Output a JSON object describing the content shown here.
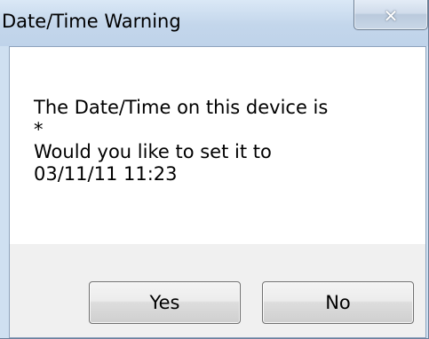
{
  "window": {
    "title": "Date/Time Warning",
    "close_icon": "close-icon",
    "close_glyph": "✕"
  },
  "message": {
    "lines": [
      "The Date/Time on this device is",
      "*",
      "Would you like to set it to",
      "03/11/11 11:23"
    ]
  },
  "buttons": {
    "yes_label": "Yes",
    "no_label": "No"
  },
  "colors": {
    "titlebar": "#c3d6eb",
    "content_bg": "#ffffff",
    "button_bar_bg": "#f0f0f0"
  }
}
